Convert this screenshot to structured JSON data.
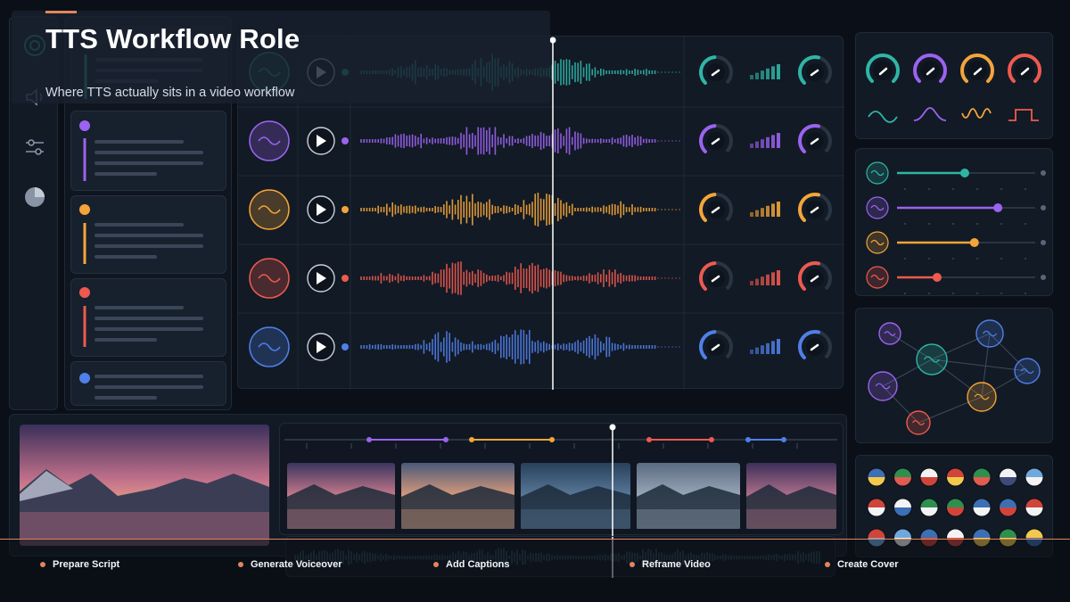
{
  "title": "TTS Workflow Role",
  "subtitle": "Where TTS actually sits in a video workflow",
  "steps": [
    {
      "label": "Prepare Script"
    },
    {
      "label": "Generate Voiceover"
    },
    {
      "label": "Add Captions"
    },
    {
      "label": "Reframe Video"
    },
    {
      "label": "Create Cover"
    }
  ],
  "colors": {
    "teal": "#2fb5a6",
    "purple": "#9b63f0",
    "orange": "#f3a53a",
    "red": "#ee5a4f",
    "blue": "#4f7fe8",
    "accent": "#e2855a"
  },
  "tracks": [
    {
      "color": "teal",
      "icon": "sine-wave-icon",
      "slider_level": 0.0
    },
    {
      "color": "purple",
      "icon": "sine-wave-icon",
      "slider_level": 0.0
    },
    {
      "color": "orange",
      "icon": "sine-wave-icon",
      "slider_level": 0.0
    },
    {
      "color": "red",
      "icon": "sine-wave-icon",
      "slider_level": 0.0
    },
    {
      "color": "blue",
      "icon": "sine-wave-icon",
      "slider_level": 0.0
    }
  ],
  "mixer_sliders": [
    {
      "color": "teal",
      "level": 0.49
    },
    {
      "color": "purple",
      "level": 0.73
    },
    {
      "color": "orange",
      "level": 0.56
    },
    {
      "color": "red",
      "level": 0.29
    }
  ],
  "rail_icons": [
    "speaker-icon",
    "sliders-icon",
    "pie-chart-icon"
  ],
  "flags": [
    "flag-se",
    "flag-it",
    "flag-jp",
    "flag-es",
    "flag-pt",
    "flag-kr",
    "flag-ar",
    "flag-cl",
    "flag-cz",
    "flag-eh",
    "flag-mx",
    "flag-pr",
    "flag-sk",
    "flag-at",
    "flag-lu",
    "flag-ar2",
    "flag-fr",
    "flag-ru",
    "flag-ro",
    "flag-br",
    "flag-ve"
  ]
}
